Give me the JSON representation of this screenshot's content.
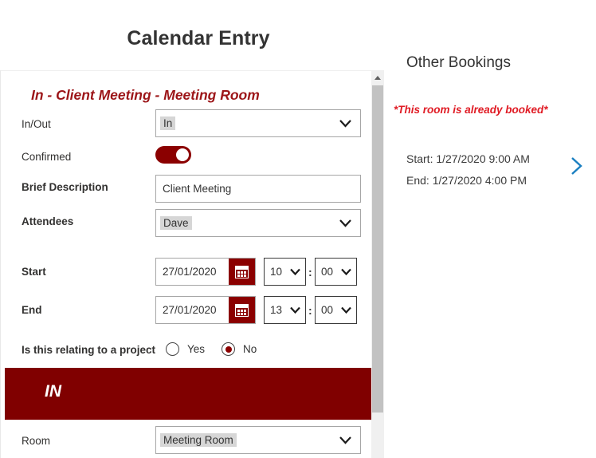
{
  "window": {
    "title": "Calendar Entry",
    "close_icon": "close-icon"
  },
  "colors": {
    "brand_dark_red": "#8b0000",
    "banner_red": "#800000",
    "heading_red": "#9c1518",
    "warning_red": "#e01b24",
    "chevron_blue": "#1a7fc1"
  },
  "form": {
    "summary_heading": "In - Client Meeting - Meeting Room",
    "fields": {
      "inout": {
        "label": "In/Out",
        "value": "In",
        "icon": "chevron-down-icon"
      },
      "confirmed": {
        "label": "Confirmed",
        "state": "on"
      },
      "description": {
        "label": "Brief Description",
        "value": "Client Meeting"
      },
      "attendees": {
        "label": "Attendees",
        "value": "Dave",
        "icon": "chevron-down-icon"
      },
      "start": {
        "label": "Start",
        "date": "27/01/2020",
        "hour": "10",
        "minute": "00",
        "separator": ":",
        "icon": "calendar-icon"
      },
      "end": {
        "label": "End",
        "date": "27/01/2020",
        "hour": "13",
        "minute": "00",
        "separator": ":",
        "icon": "calendar-icon"
      },
      "project": {
        "label": "Is this relating to a project",
        "options": [
          {
            "label": "Yes",
            "selected": false
          },
          {
            "label": "No",
            "selected": true
          }
        ]
      },
      "room": {
        "label": "Room",
        "value": "Meeting Room",
        "icon": "chevron-down-icon"
      }
    },
    "banner": {
      "text": "IN"
    }
  },
  "scrollbar": {
    "up_icon": "scroll-up-arrow-icon"
  },
  "other_bookings": {
    "title": "Other Bookings",
    "warning": "*This room is already booked*",
    "bookings": [
      {
        "start": "Start: 1/27/2020 9:00 AM",
        "end": "End: 1/27/2020 4:00 PM"
      }
    ],
    "next_icon": "chevron-right-icon"
  }
}
